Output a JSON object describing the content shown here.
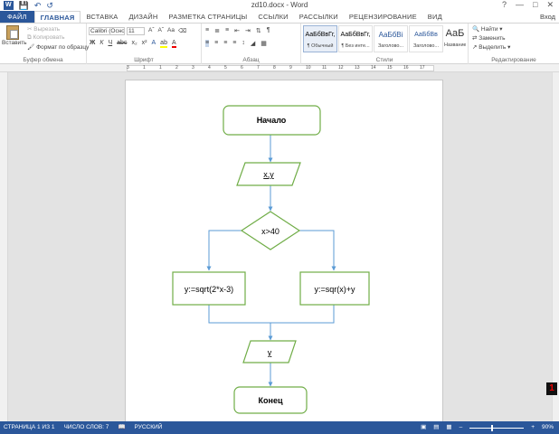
{
  "window": {
    "title": "zd10.docx - Word",
    "sign_in": "Вход"
  },
  "tabs": [
    "ФАЙЛ",
    "ГЛАВНАЯ",
    "ВСТАВКА",
    "ДИЗАЙН",
    "РАЗМЕТКА СТРАНИЦЫ",
    "ССЫЛКИ",
    "РАССЫЛКИ",
    "РЕЦЕНЗИРОВАНИЕ",
    "ВИД"
  ],
  "ribbon": {
    "clipboard": {
      "paste": "Вставить",
      "cut": "Вырезать",
      "copy": "Копировать",
      "format_painter": "Формат по образцу",
      "label": "Буфер обмена"
    },
    "font": {
      "font_name": "Calibri (Осно",
      "font_size": "11",
      "label": "Шрифт"
    },
    "paragraph": {
      "label": "Абзац"
    },
    "styles": {
      "items": [
        {
          "sample": "АаБбВвГг,",
          "name": "¶ Обычный"
        },
        {
          "sample": "АаБбВвГг,",
          "name": "¶ Без инте..."
        },
        {
          "sample": "АаБбВі",
          "name": "Заголово..."
        },
        {
          "sample": "АаБбВв",
          "name": "Заголово..."
        },
        {
          "sample": "АаБ",
          "name": "Название"
        }
      ],
      "label": "Стили"
    },
    "editing": {
      "find": "Найти",
      "replace": "Заменить",
      "select": "Выделить",
      "label": "Редактирование"
    }
  },
  "ruler_numbers": [
    "3",
    "1",
    "1",
    "2",
    "3",
    "4",
    "5",
    "6",
    "7",
    "8",
    "9",
    "10",
    "11",
    "12",
    "13",
    "14",
    "15",
    "16",
    "17"
  ],
  "flowchart": {
    "start": "Начало",
    "input": "x,y",
    "condition": "x>40",
    "left_action": "y:=sqrt(2*x-3)",
    "right_action": "y:=sqr(x)+y",
    "output": "y",
    "end": "Конец",
    "stroke_color": "#70ad47",
    "arrow_color": "#5b9bd5"
  },
  "status": {
    "page": "СТРАНИЦА 1 ИЗ 1",
    "words": "ЧИСЛО СЛОВ: 7",
    "language": "РУССКИЙ",
    "zoom": "90%"
  },
  "overlay_badge": "1"
}
